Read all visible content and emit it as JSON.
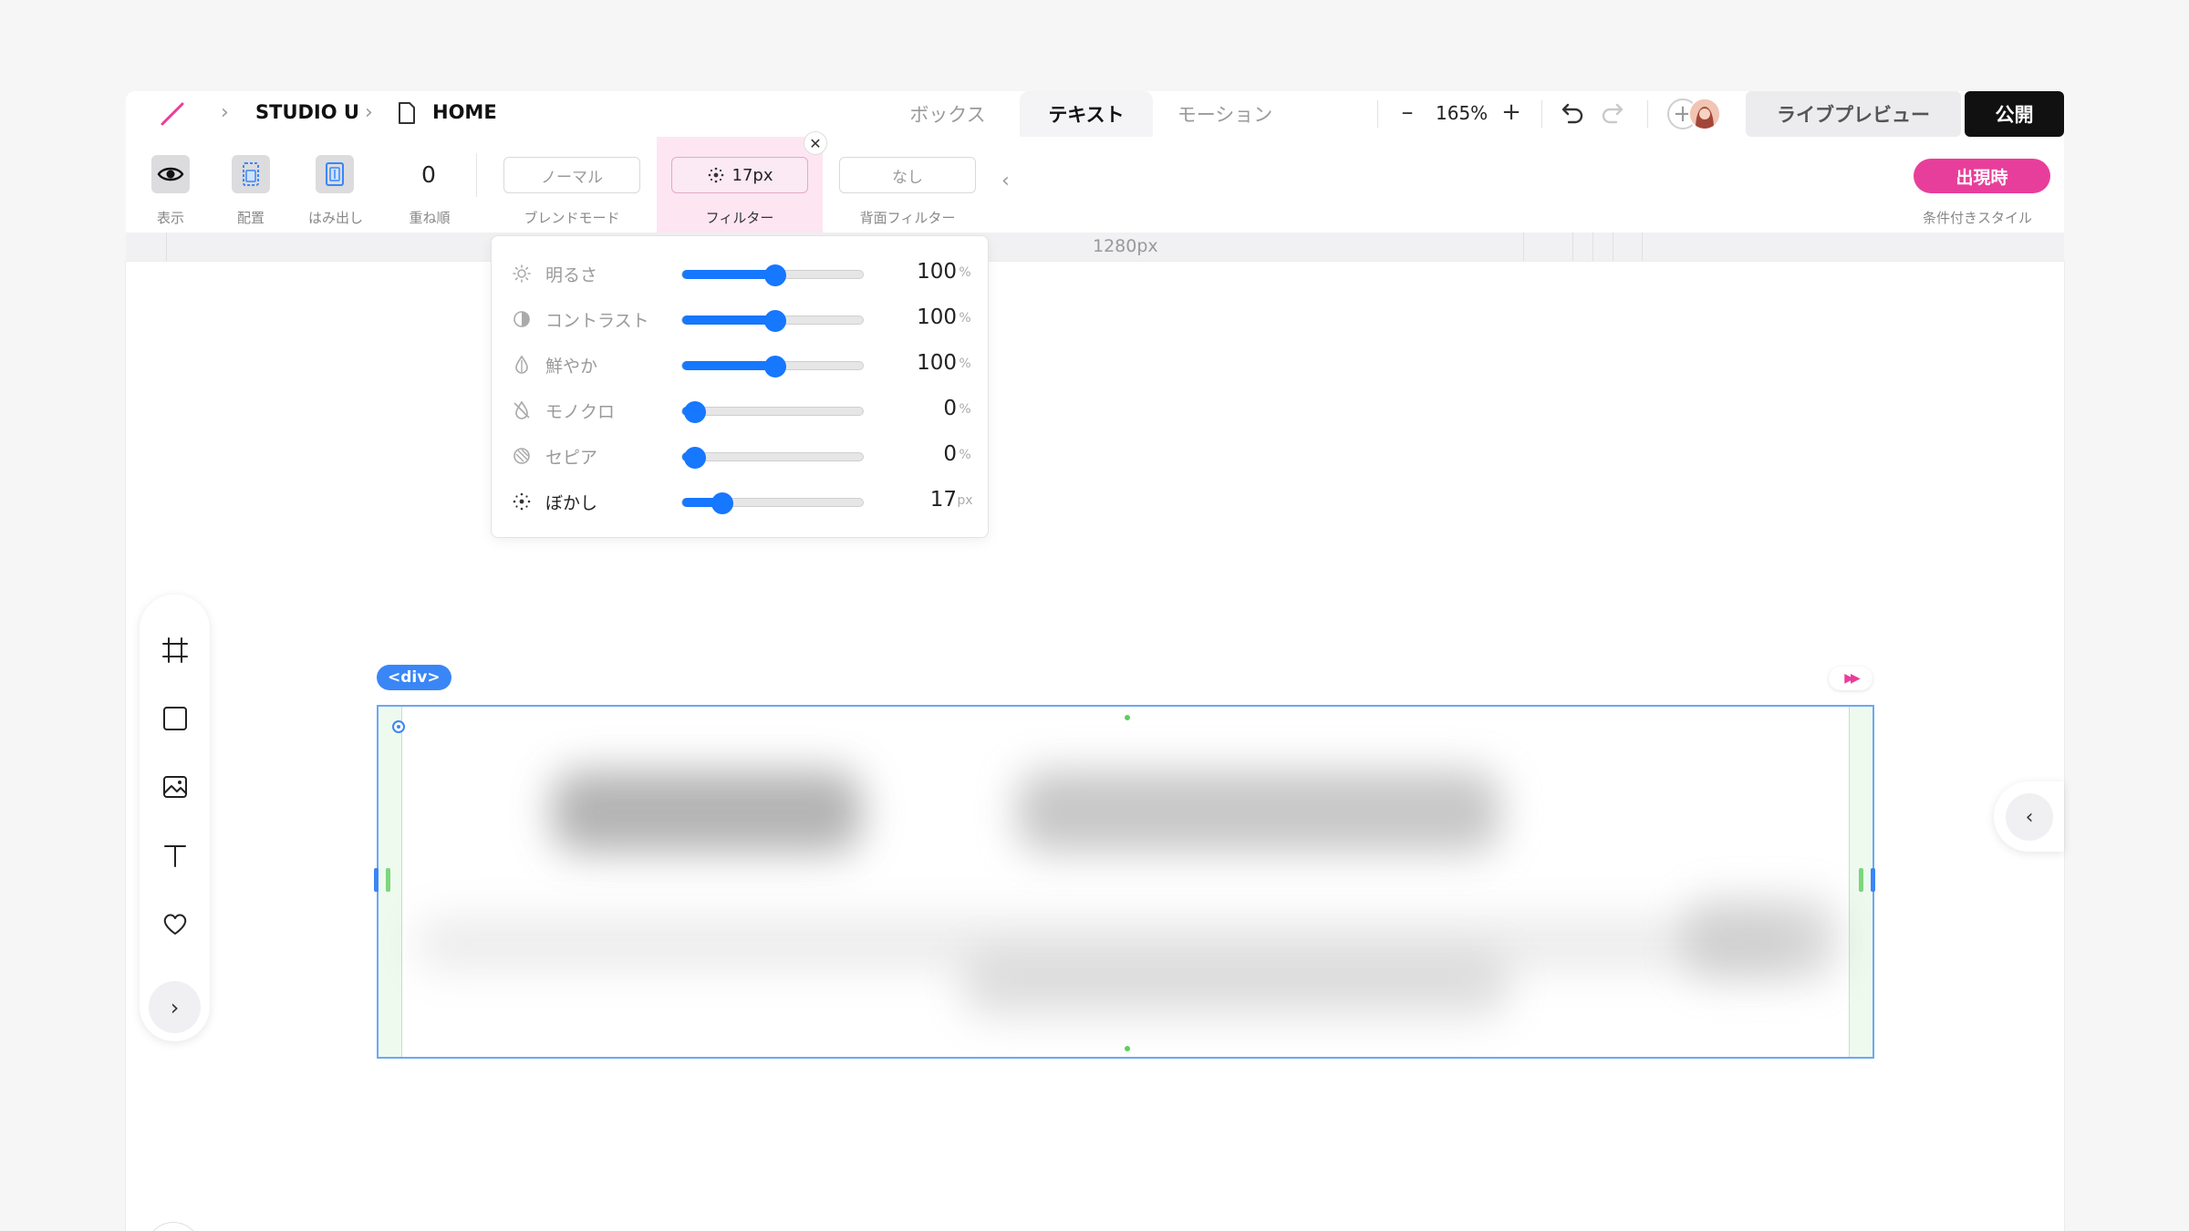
{
  "header": {
    "breadcrumb": [
      "STUDIO U",
      "HOME"
    ],
    "tabs": [
      {
        "label": "ボックス",
        "active": false
      },
      {
        "label": "テキスト",
        "active": true
      },
      {
        "label": "モーション",
        "active": false
      }
    ],
    "zoom": "165%",
    "zoom_out": "–",
    "zoom_in": "+",
    "live_preview": "ライブプレビュー",
    "publish": "公開"
  },
  "toolbar": {
    "visibility_label": "表示",
    "position_label": "配置",
    "overflow_label": "はみ出し",
    "zindex_value": "0",
    "zindex_label": "重ね順",
    "blend_value": "ノーマル",
    "blend_label": "ブレンドモード",
    "filter_value": "17px",
    "filter_label": "フィルター",
    "backdrop_value": "なし",
    "backdrop_label": "背面フィルター",
    "appear_button": "出現時",
    "conditional_label": "条件付きスタイル"
  },
  "ruler": {
    "label": "1280px"
  },
  "filter_popover": {
    "rows": [
      {
        "name": "明るさ",
        "value": "100",
        "unit": "%",
        "fraction": 0.5,
        "icon": "sun-icon",
        "active": false
      },
      {
        "name": "コントラスト",
        "value": "100",
        "unit": "%",
        "fraction": 0.5,
        "icon": "contrast-icon",
        "active": false
      },
      {
        "name": "鮮やか",
        "value": "100",
        "unit": "%",
        "fraction": 0.5,
        "icon": "drop-icon",
        "active": false
      },
      {
        "name": "モノクロ",
        "value": "0",
        "unit": "%",
        "fraction": 0.0,
        "icon": "drop-slash-icon",
        "active": false
      },
      {
        "name": "セピア",
        "value": "0",
        "unit": "%",
        "fraction": 0.0,
        "icon": "hatched-circle-icon",
        "active": false
      },
      {
        "name": "ぼかし",
        "value": "17",
        "unit": "px",
        "fraction": 0.17,
        "icon": "blur-dots-icon",
        "active": true
      }
    ]
  },
  "selection": {
    "tag": "<div>"
  },
  "tools": {
    "expand": "›"
  },
  "side_panel": {
    "toggle": "‹"
  },
  "colors": {
    "accent": "#1677ff",
    "brand_pink": "#e83e9b",
    "selection": "#6ea6f5"
  }
}
